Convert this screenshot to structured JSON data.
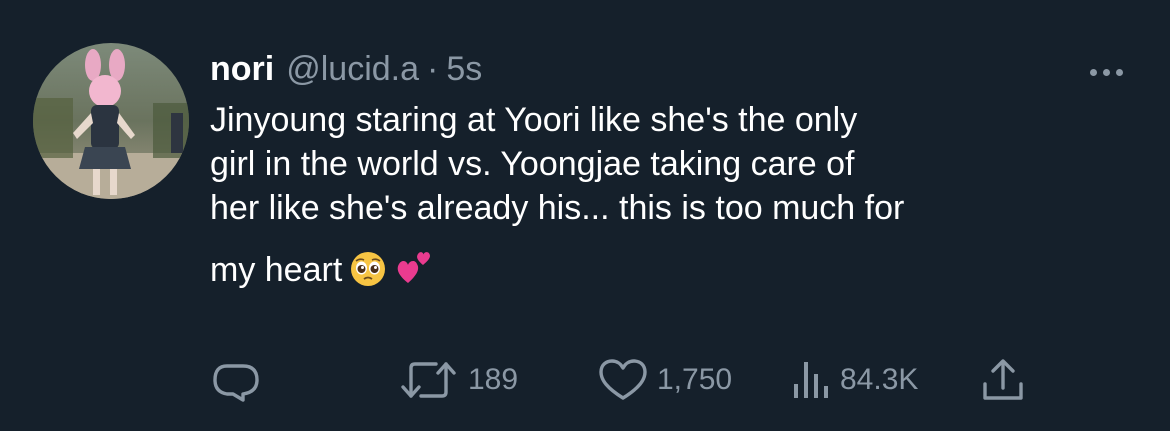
{
  "tweet": {
    "display_name": "nori",
    "handle": "@lucid.a",
    "separator": "·",
    "time": "5s",
    "text_lines": [
      "Jinyoung staring at Yoori like she's the only",
      "girl in the world vs. Yoongjae taking care of",
      "her like she's already his... this is too much for",
      "my heart"
    ],
    "emojis": [
      "pleading-face",
      "two-hearts"
    ]
  },
  "actions": {
    "reply": {
      "icon": "reply-icon"
    },
    "retweet": {
      "icon": "retweet-icon",
      "count": "189"
    },
    "like": {
      "icon": "heart-icon",
      "count": "1,750"
    },
    "views": {
      "icon": "views-icon",
      "count": "84.3K"
    },
    "share": {
      "icon": "share-icon"
    }
  },
  "colors": {
    "background": "#15202b",
    "text": "#ffffff",
    "muted": "#8b98a5"
  }
}
